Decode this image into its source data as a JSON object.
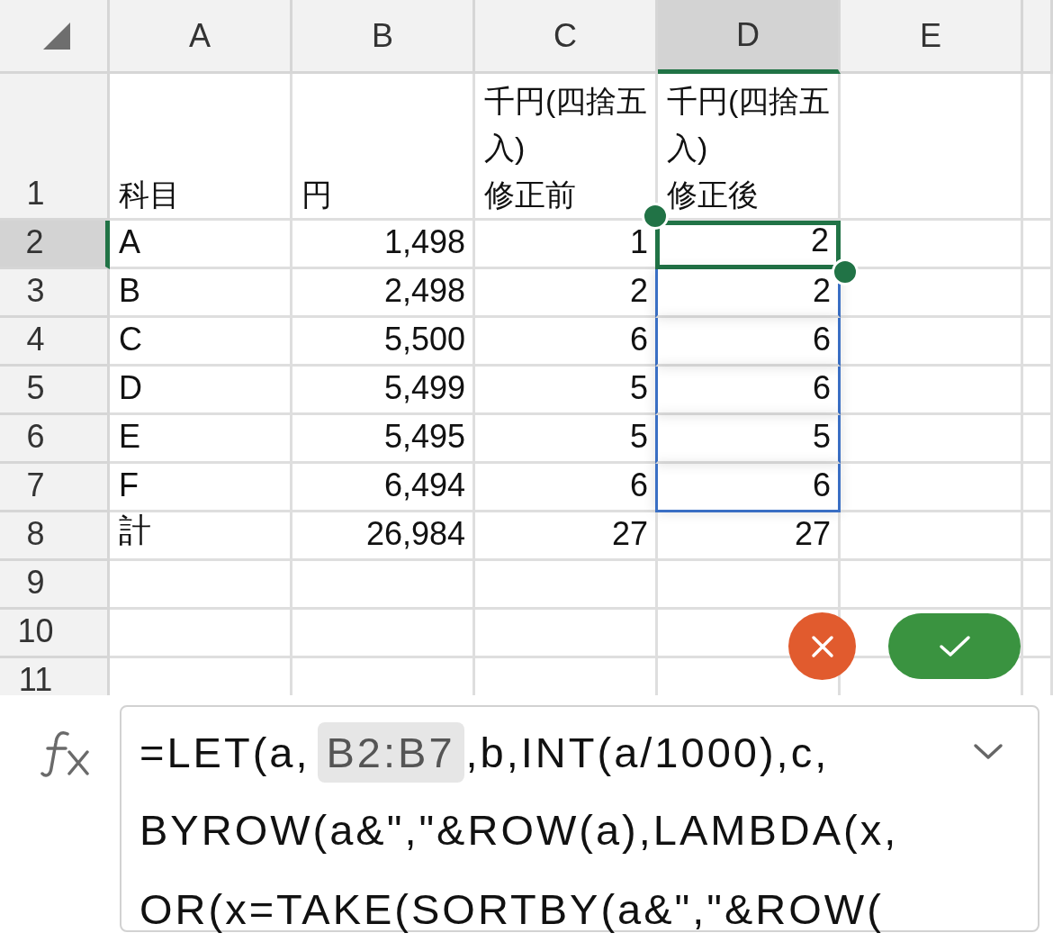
{
  "columns": [
    {
      "label": "A",
      "selected": false
    },
    {
      "label": "B",
      "selected": false
    },
    {
      "label": "C",
      "selected": false
    },
    {
      "label": "D",
      "selected": true
    },
    {
      "label": "E",
      "selected": false
    }
  ],
  "rows": [
    {
      "label": "1",
      "selected": false,
      "cells": [
        {
          "text": "科目",
          "kind": "header",
          "selected": false
        },
        {
          "text": "円",
          "kind": "header",
          "selected": false
        },
        {
          "text": "千円(四捨五入)\n修正前",
          "kind": "header",
          "selected": false
        },
        {
          "text": "千円(四捨五入)\n修正後",
          "kind": "header",
          "selected": false
        }
      ]
    },
    {
      "label": "2",
      "selected": true,
      "cells": [
        {
          "text": "A",
          "kind": "text",
          "selected": false
        },
        {
          "text": "1,498",
          "kind": "number",
          "selected": false
        },
        {
          "text": "1",
          "kind": "number",
          "selected": false
        },
        {
          "text": "2",
          "kind": "number",
          "selected": true
        }
      ]
    },
    {
      "label": "3",
      "selected": false,
      "cells": [
        {
          "text": "B",
          "kind": "text",
          "selected": false
        },
        {
          "text": "2,498",
          "kind": "number",
          "selected": false
        },
        {
          "text": "2",
          "kind": "number",
          "selected": false
        },
        {
          "text": "2",
          "kind": "number",
          "selected": true
        }
      ]
    },
    {
      "label": "4",
      "selected": false,
      "cells": [
        {
          "text": "C",
          "kind": "text",
          "selected": false
        },
        {
          "text": "5,500",
          "kind": "number",
          "selected": false
        },
        {
          "text": "6",
          "kind": "number",
          "selected": false
        },
        {
          "text": "6",
          "kind": "number",
          "selected": true
        }
      ]
    },
    {
      "label": "5",
      "selected": false,
      "cells": [
        {
          "text": "D",
          "kind": "text",
          "selected": false
        },
        {
          "text": "5,499",
          "kind": "number",
          "selected": false
        },
        {
          "text": "5",
          "kind": "number",
          "selected": false
        },
        {
          "text": "6",
          "kind": "number",
          "selected": true
        }
      ]
    },
    {
      "label": "6",
      "selected": false,
      "cells": [
        {
          "text": "E",
          "kind": "text",
          "selected": false
        },
        {
          "text": "5,495",
          "kind": "number",
          "selected": false
        },
        {
          "text": "5",
          "kind": "number",
          "selected": false
        },
        {
          "text": "5",
          "kind": "number",
          "selected": true
        }
      ]
    },
    {
      "label": "7",
      "selected": false,
      "cells": [
        {
          "text": "F",
          "kind": "text",
          "selected": false
        },
        {
          "text": "6,494",
          "kind": "number",
          "selected": false
        },
        {
          "text": "6",
          "kind": "number",
          "selected": false
        },
        {
          "text": "6",
          "kind": "number",
          "selected": true
        }
      ]
    },
    {
      "label": "8",
      "selected": false,
      "cells": [
        {
          "text": "計",
          "kind": "text",
          "selected": false
        },
        {
          "text": "26,984",
          "kind": "number",
          "selected": false
        },
        {
          "text": "27",
          "kind": "number",
          "selected": false
        },
        {
          "text": "27",
          "kind": "number",
          "selected": false
        }
      ]
    },
    {
      "label": "9",
      "selected": false,
      "cells": []
    },
    {
      "label": "10",
      "selected": false,
      "cells": []
    },
    {
      "label": "11",
      "selected": false,
      "cells": []
    }
  ],
  "formula": {
    "lines": [
      [
        {
          "text": "=LET(a,",
          "ref": false
        },
        {
          "text": "B2:B7",
          "ref": true
        },
        {
          "text": ",b,INT(a/1000),c,",
          "ref": false
        }
      ],
      [
        {
          "text": "BYROW(a&\",\"&ROW(a),LAMBDA(x,",
          "ref": false
        }
      ],
      [
        {
          "text": "OR(x=TAKE(SORTBY(a&\",\"&ROW(",
          "ref": false
        }
      ]
    ]
  }
}
